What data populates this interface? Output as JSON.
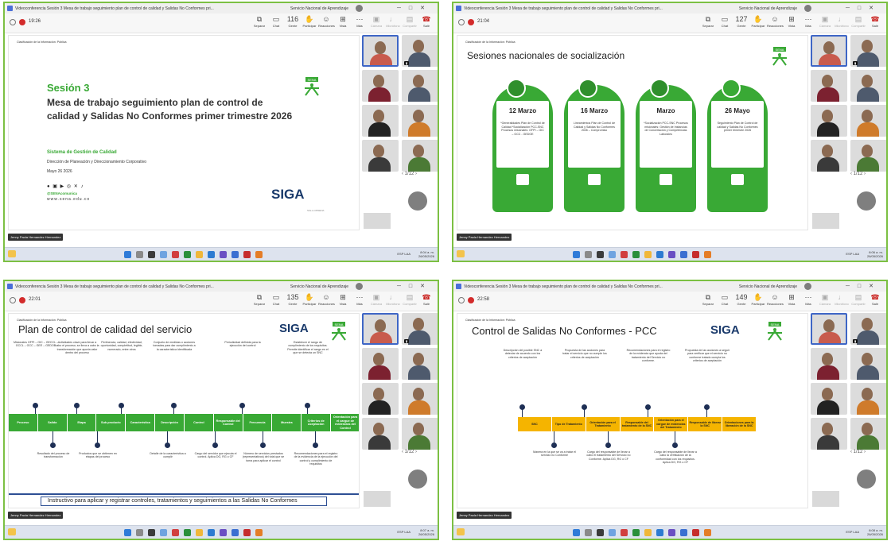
{
  "window": {
    "title": "Videoconferencia Sesión 3 Mesa de trabajo seguimiento plan de control de calidad y Salidas No Conformes pri...",
    "org": "Servicio Nacional de Aprendizaje"
  },
  "toolbar": {
    "share": "Separar",
    "chat": "Chat",
    "people": "Gente",
    "raise": "Participar",
    "react": "Reacciones",
    "view": "Vista",
    "more": "Más",
    "camera": "Cámara",
    "mic": "Micrófono",
    "sharescreen": "Compartir",
    "leave": "Salir"
  },
  "common": {
    "classification": "Clasificación de la Información: Pública",
    "presenter": "Jenny Paola Hernandez Hernandez",
    "pagination": "1/12",
    "lang": "ESP LAA",
    "date": "26/05/2026"
  },
  "panels": [
    {
      "time": "19:26",
      "people_count": "116",
      "clock": "8:04 a. m."
    },
    {
      "time": "21:04",
      "people_count": "127",
      "clock": "8:06 a. m."
    },
    {
      "time": "22:01",
      "people_count": "135",
      "clock": "8:07 a. m."
    },
    {
      "time": "22:58",
      "people_count": "149",
      "clock": "8:08 a. m."
    }
  ],
  "slide1": {
    "title": "Sesión 3",
    "subtitle": "Mesa de trabajo seguimiento plan de control de calidad y Salidas No Conformes primer trimestre 2026",
    "system": "Sistema de Gestión de Calidad",
    "direction": "Dirección de Planeación y Direccionamiento Corporativo",
    "date": "Mayo 26 2026",
    "handle": "@SENAcomunica",
    "web": "www.sena.edu.co",
    "brand": "SIGA",
    "brand_small": "SIG-A-CBSENA"
  },
  "slide2": {
    "title": "Sesiones nacionales de socialización",
    "cards": [
      {
        "date": "12 Marzo",
        "text": "*Generalidades Plan de Control de Calidad *Socialización PCC-SNC Procesos misionales: GFPI – GIC – GCC - GEDOE"
      },
      {
        "date": "16 Marzo",
        "text": "Lineamientos Plan de Control de Calidad y Salidas No Conformes 2026 – Compromiso"
      },
      {
        "date": "Marzo",
        "text": "*Socialización PCC-SNC Procesos misionales: Gestión de Instancias de Concertación y Competencias Laborales"
      },
      {
        "date": "26 Mayo",
        "text": "Seguimiento Plan de Control de calidad y Salidas No Conformes primer trimestre 2026"
      }
    ]
  },
  "slide3": {
    "title": "Plan de control de calidad del servicio",
    "band": [
      "Proceso",
      "Salida",
      "Etapa",
      "Sub producto",
      "Característica",
      "Descripción",
      "Control",
      "Responsable del Control",
      "Frecuencia",
      "Muestra",
      "Criterios de Aceptación",
      "Orientación para el cargue de evidencias del Control"
    ],
    "top_notes": [
      "Misionales GFPI – GIC – GECCL – GCCL – GCC – GEE – GEDOE",
      "Actividades clave para llevar a cabo el proceso; se lleva a cabo la transformación que aporta valor dentro del proceso",
      "Pertinencia, calidad, efectividad, oportunidad, completitud, legible, numerado, entre otros",
      "Conjunto de medidas o acciones tomadas para dar cumplimiento a la característica identificada",
      "Periodicidad definida para la ejecución del control",
      "Establecer el rango de cumplimiento de los requisitos. Permite identificar el rango en el que se detecta un SNC"
    ],
    "bottom_notes": [
      "Resultado del proceso de transformación",
      "Productos que se obtienen en etapas del proceso",
      "Detalle de la característica a cumplir",
      "Cargo del servidor que ejecuta el control. Aplica DG, RG o CF",
      "Número de servicios prestados (representativos) del total que se toma para aplicar el control",
      "Recomendaciones para el registro de la evidencia de la ejecución del control y cumplimiento de requisitos"
    ],
    "footer": "Instructivo para aplicar y registrar controles, tratamientos  y seguimientos a las Salidas No Conformes"
  },
  "slide4": {
    "title": "Control de Salidas No Conformes - PCC",
    "band": [
      "SNC",
      "Tipo de Tratamiento",
      "Orientación para el Tratamiento",
      "Responsable del tratamiento de la SNC",
      "Orientación para el cargue de evidencias del Tratamiento",
      "Responsable de liberar la SNC",
      "Orientaciones para la liberación de la SNC"
    ],
    "top_notes": [
      "Descripción del posible SNC a detectar de acuerdo con los criterios de aceptación",
      "Propuesta de las acciones para tratar el servicio que no cumple los criterios de aceptación",
      "Recomendaciones para el registro de la evidencia que ayuda del tratamiento del Servicio no conforme.",
      "Propuesta de las acciones a seguir para verificar que el servicio no conforme tratado cumpla los criterios de aceptación"
    ],
    "bottom_notes": [
      "Manera en la que se va a tratar el servicio no Conforme",
      "Cargo del responsable de llevar a cabo el tratamiento del Servicio no Conforme. Aplica DG, RG o CF",
      "Cargo del responsable de llevar a cabo la verificación de la conformidad con los requisitos. Aplica DG, RG o CF"
    ]
  },
  "colors": {
    "green": "#39a935",
    "amber": "#f5b400",
    "navy": "#1e2f55",
    "frame": "#7cc043",
    "selected": "#3e66c6"
  }
}
